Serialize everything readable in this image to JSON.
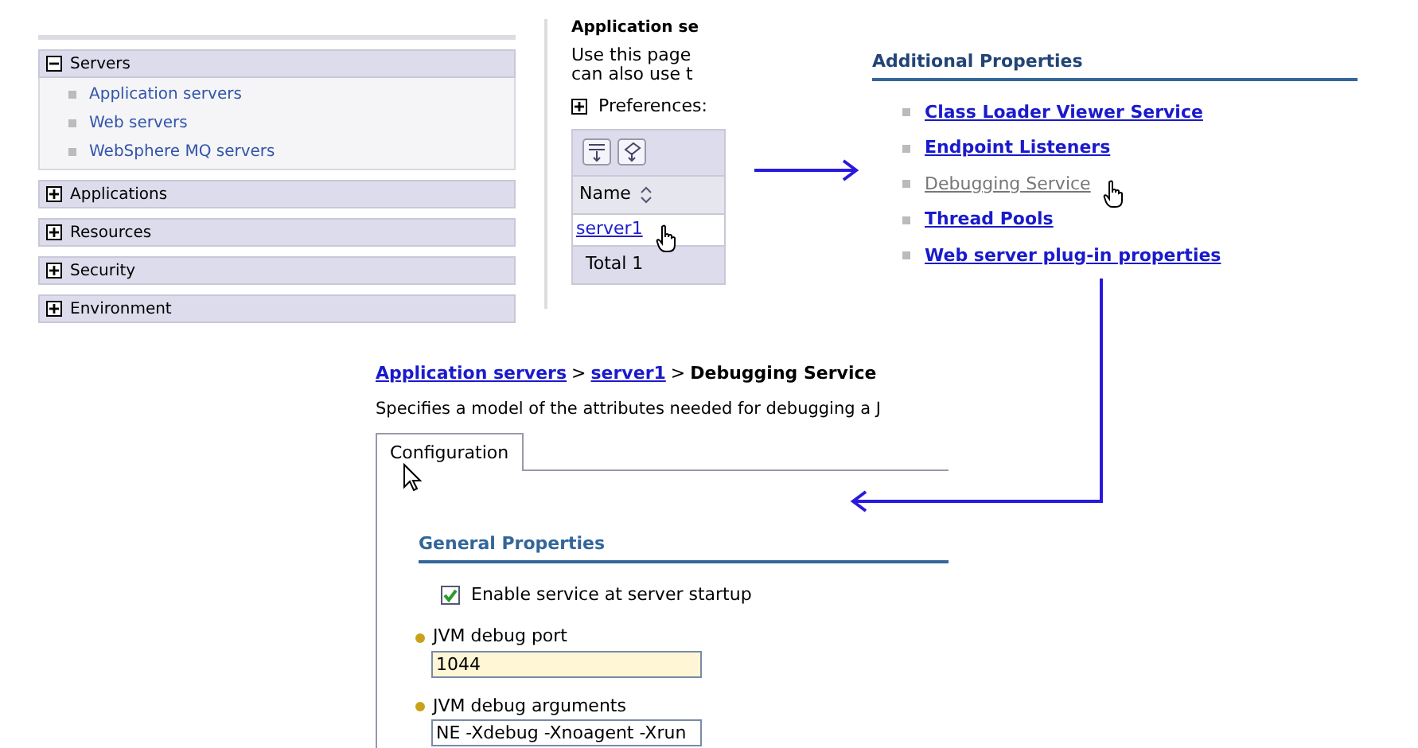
{
  "navigation": {
    "groups": [
      {
        "label": "Servers",
        "expanded": true,
        "items": [
          "Application servers",
          "Web servers",
          "WebSphere MQ servers"
        ]
      },
      {
        "label": "Applications",
        "expanded": false
      },
      {
        "label": "Resources",
        "expanded": false
      },
      {
        "label": "Security",
        "expanded": false
      },
      {
        "label": "Environment",
        "expanded": false
      }
    ]
  },
  "server_list": {
    "heading": "Application se",
    "description": [
      "Use this page",
      "can also use t"
    ],
    "preferences": "Preferences:",
    "column": "Name",
    "rows": [
      "server1"
    ],
    "total": "Total 1"
  },
  "additional_properties": {
    "title": "Additional Properties",
    "links": [
      {
        "label": "Class Loader Viewer Service",
        "visited": false
      },
      {
        "label": "Endpoint Listeners",
        "visited": false
      },
      {
        "label": "Debugging Service",
        "visited": true
      },
      {
        "label": "Thread Pools",
        "visited": false
      },
      {
        "label": "Web server plug-in properties",
        "visited": false
      }
    ]
  },
  "debugging_page": {
    "breadcrumb": [
      {
        "kind": "link",
        "label": "Application servers"
      },
      {
        "kind": "separator",
        "label": ">"
      },
      {
        "kind": "link",
        "label": "server1"
      },
      {
        "kind": "separator",
        "label": ">"
      },
      {
        "kind": "current",
        "label": "Debugging Service"
      }
    ],
    "description": "Specifies a model of the attributes needed for debugging a J",
    "tabs": [
      {
        "label": "Configuration",
        "selected": true
      }
    ],
    "section": "General Properties",
    "fields": [
      {
        "kind": "checkbox",
        "label": "Enable service at server startup",
        "checked": true
      },
      {
        "kind": "text",
        "label": "JVM debug port",
        "required": true,
        "value": "1044",
        "highlighted": true
      },
      {
        "kind": "text",
        "label": "JVM debug arguments",
        "required": true,
        "value": "NE -Xdebug -Xnoagent -Xrun",
        "highlighted": false
      }
    ]
  }
}
